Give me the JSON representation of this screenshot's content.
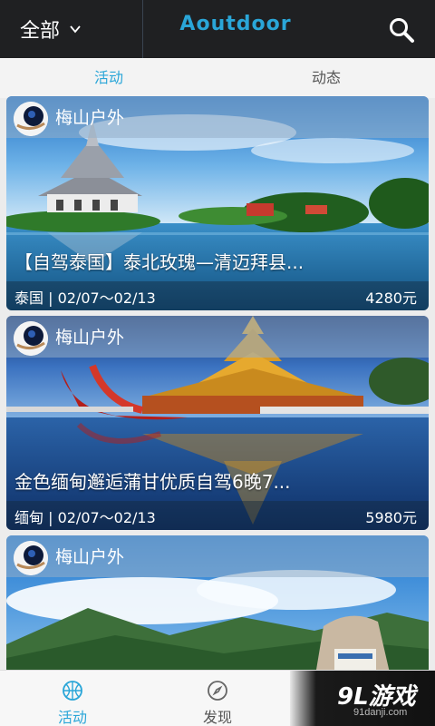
{
  "header": {
    "filter_label": "全部",
    "brand": "Aoutdoor",
    "icons": {
      "filter_chevron": "chevron-down-icon",
      "search": "search-icon"
    }
  },
  "tabs": [
    {
      "label": "活动",
      "active": true
    },
    {
      "label": "动态",
      "active": false
    }
  ],
  "feed": [
    {
      "org": "梅山户外",
      "title": "【自驾泰国】泰北玫瑰—清迈拜县...",
      "destination": "泰国 | 02/07～02/13",
      "price": "4280元"
    },
    {
      "org": "梅山户外",
      "title": "金色缅甸邂逅蒲甘优质自驾6晚7...",
      "destination": "缅甸 | 02/07～02/13",
      "price": "5980元"
    },
    {
      "org": "梅山户外"
    }
  ],
  "bottom_nav": [
    {
      "label": "活动",
      "icon": "basketball-icon",
      "active": true
    },
    {
      "label": "发现",
      "icon": "compass-icon",
      "active": false
    }
  ],
  "watermark": {
    "main": "9L游戏",
    "sub": "91danji.com"
  },
  "colors": {
    "accent": "#2aa6d8",
    "topbar": "#1f2022"
  }
}
